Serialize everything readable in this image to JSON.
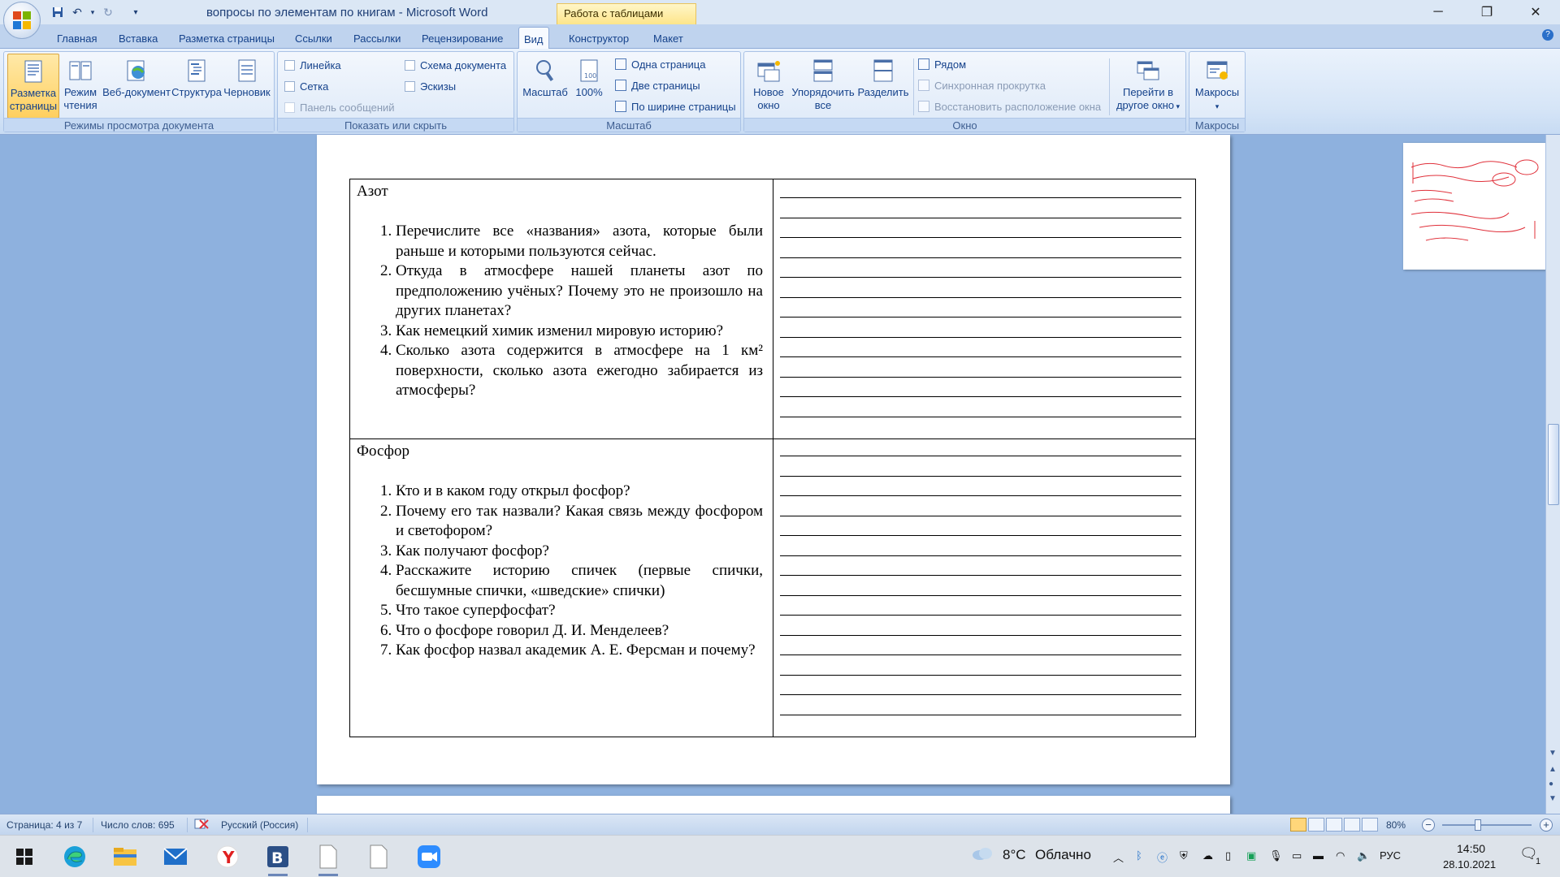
{
  "window": {
    "title": "вопросы по элементам по книгам - Microsoft Word",
    "context_tab_group": "Работа с таблицами"
  },
  "tabs": [
    {
      "label": "Главная"
    },
    {
      "label": "Вставка"
    },
    {
      "label": "Разметка страницы"
    },
    {
      "label": "Ссылки"
    },
    {
      "label": "Рассылки"
    },
    {
      "label": "Рецензирование"
    },
    {
      "label": "Вид",
      "active": true
    },
    {
      "label": "Конструктор"
    },
    {
      "label": "Макет"
    }
  ],
  "ribbon": {
    "views": {
      "label": "Режимы просмотра документа",
      "buttons": [
        {
          "label1": "Разметка",
          "label2": "страницы",
          "selected": true
        },
        {
          "label1": "Режим",
          "label2": "чтения"
        },
        {
          "label1": "Веб-документ",
          "label2": ""
        },
        {
          "label1": "Структура",
          "label2": ""
        },
        {
          "label1": "Черновик",
          "label2": ""
        }
      ]
    },
    "show": {
      "label": "Показать или скрыть",
      "items": [
        {
          "label": "Линейка",
          "checked": false
        },
        {
          "label": "Сетка",
          "checked": false
        },
        {
          "label": "Панель сообщений",
          "checked": false,
          "disabled": true
        },
        {
          "label": "Схема документа",
          "checked": false
        },
        {
          "label": "Эскизы",
          "checked": false
        }
      ]
    },
    "zoom": {
      "label": "Масштаб",
      "zoom_button": "Масштаб",
      "percent_button": "100%",
      "one_page": "Одна страница",
      "two_pages": "Две страницы",
      "page_width": "По ширине страницы"
    },
    "window": {
      "label": "Окно",
      "new_window": {
        "label1": "Новое",
        "label2": "окно"
      },
      "arrange_all": {
        "label1": "Упорядочить",
        "label2": "все"
      },
      "split": {
        "label1": "Разделить",
        "label2": ""
      },
      "side_by_side": "Рядом",
      "sync_scroll": "Синхронная прокрутка",
      "reset_position": "Восстановить расположение окна",
      "switch_windows": {
        "label1": "Перейти в",
        "label2": "другое окно"
      }
    },
    "macros": {
      "label": "Макросы",
      "button": "Макросы"
    }
  },
  "document": {
    "sections": [
      {
        "heading": "Азот",
        "questions": [
          "Перечислите все «названия» азота, которые были раньше и которыми пользуются сейчас.",
          "Откуда в атмосфере нашей планеты азот по предположению учёных? Почему это не произошло на других планетах?",
          "Как немецкий химик изменил мировую историю?",
          "Сколько азота содержится в атмосфере на 1 км² поверхности, сколько азота ежегодно забирается из атмосферы?"
        ]
      },
      {
        "heading": "Фосфор",
        "questions": [
          "Кто и в каком году открыл фосфор?",
          "Почему его так назвали? Какая связь между фосфором и светофором?",
          "Как получают фосфор?",
          "Расскажите историю спичек (первые спички, бесшумные спички, «шведские» спички)",
          "Что такое суперфосфат?",
          "Что о фосфоре говорил Д. И. Менделеев?",
          "Как фосфор назвал академик А. Е. Ферсман и почему?"
        ]
      }
    ]
  },
  "statusbar": {
    "page": "Страница: 4 из 7",
    "words": "Число слов: 695",
    "language": "Русский (Россия)",
    "zoom": "80%"
  },
  "taskbar": {
    "weather_temp": "8°C",
    "weather_text": "Облачно",
    "lang": "РУС",
    "time": "14:50",
    "date": "28.10.2021",
    "notifications": "1"
  },
  "colors": {
    "ribbon_bg": "#d6e5f7",
    "doc_bg": "#8eb1de",
    "selected_btn": "#ffcf5f",
    "ink_red": "#e0303a"
  }
}
